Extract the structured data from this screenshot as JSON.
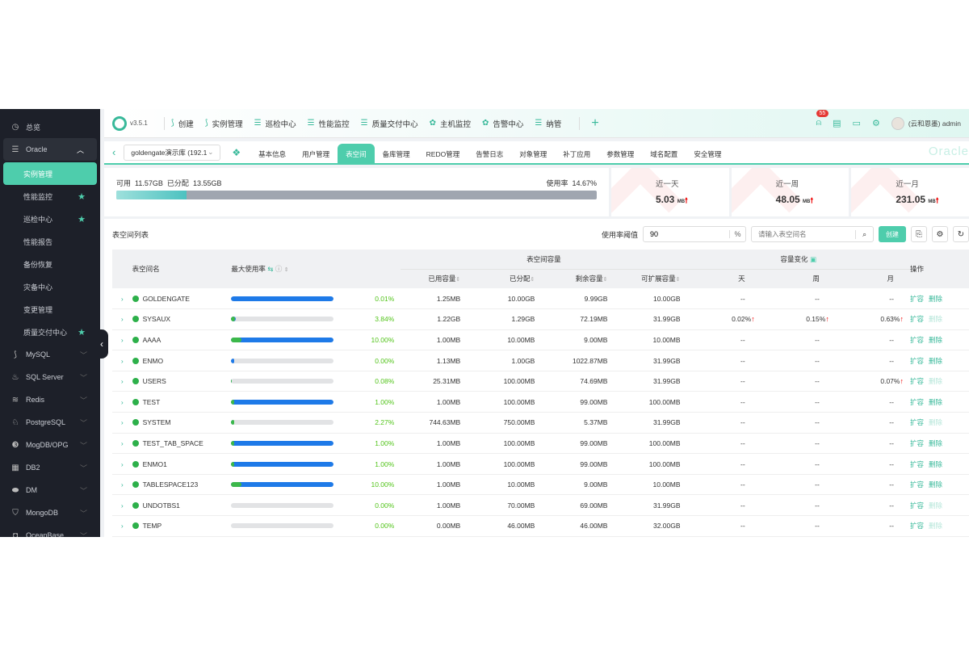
{
  "sidebar": {
    "overview": "总览",
    "oracle": "Oracle",
    "oracle_items": [
      {
        "label": "实例管理",
        "active": true,
        "star": false
      },
      {
        "label": "性能监控",
        "star": true
      },
      {
        "label": "巡检中心",
        "star": true
      },
      {
        "label": "性能报告",
        "star": false
      },
      {
        "label": "备份恢复",
        "star": false
      },
      {
        "label": "灾备中心",
        "star": false
      },
      {
        "label": "变更管理",
        "star": false
      },
      {
        "label": "质量交付中心",
        "star": true
      }
    ],
    "groups": [
      "MySQL",
      "SQL Server",
      "Redis",
      "PostgreSQL",
      "MogDB/OPG",
      "DB2",
      "DM",
      "MongoDB",
      "OceanBase"
    ]
  },
  "topbar": {
    "version": "v3.5.1",
    "nav": [
      "创建",
      "实例管理",
      "巡检中心",
      "性能监控",
      "质量交付中心",
      "主机监控",
      "告警中心",
      "纳管"
    ],
    "alert_count": "55",
    "user": "(云和恩墨) admin"
  },
  "subbar": {
    "instance": "goldengate演示库 (192.1",
    "tabs": [
      "基本信息",
      "用户管理",
      "表空间",
      "备库管理",
      "REDO管理",
      "告警日志",
      "对象管理",
      "补丁应用",
      "参数管理",
      "域名配置",
      "安全管理"
    ],
    "active_tab": "表空间",
    "brand": "Oracle"
  },
  "usage": {
    "available_label": "可用",
    "available": "11.57GB",
    "allocated_label": "已分配",
    "allocated": "13.55GB",
    "rate_label": "使用率",
    "rate": "14.67%",
    "rate_value": 14.67
  },
  "growth": [
    {
      "label": "近一天",
      "value": "5.03",
      "unit": "MB"
    },
    {
      "label": "近一周",
      "value": "48.05",
      "unit": "MB"
    },
    {
      "label": "近一月",
      "value": "231.05",
      "unit": "MB"
    }
  ],
  "list": {
    "title": "表空间列表",
    "threshold_label": "使用率阈值",
    "threshold": "90",
    "threshold_unit": "%",
    "search_placeholder": "请输入表空间名",
    "create": "创建",
    "headers": {
      "name": "表空间名",
      "max_usage": "最大使用率",
      "capacity": "表空间容量",
      "used": "已用容量",
      "allocated": "已分配",
      "remaining": "剩余容量",
      "extendable": "可扩展容量",
      "change": "容量变化",
      "day": "天",
      "week": "周",
      "month": "月",
      "ops": "操作"
    },
    "op_expand": "扩容",
    "op_delete": "删除",
    "rows": [
      {
        "name": "GOLDENGATE",
        "pct": "0.01%",
        "used_fill": 0.01,
        "alloc_fill": 100,
        "used": "1.25MB",
        "allocated": "10.00GB",
        "remaining": "9.99GB",
        "extendable": "10.00GB",
        "day": "--",
        "week": "--",
        "month": "--",
        "delete_enabled": true
      },
      {
        "name": "SYSAUX",
        "pct": "3.84%",
        "used_fill": 3.84,
        "alloc_fill": 4,
        "used": "1.22GB",
        "allocated": "1.29GB",
        "remaining": "72.19MB",
        "extendable": "31.99GB",
        "day": "0.02%",
        "week": "0.15%",
        "month": "0.63%",
        "delete_enabled": false
      },
      {
        "name": "AAAA",
        "pct": "10.00%",
        "used_fill": 10,
        "alloc_fill": 100,
        "used": "1.00MB",
        "allocated": "10.00MB",
        "remaining": "9.00MB",
        "extendable": "10.00MB",
        "day": "--",
        "week": "--",
        "month": "--",
        "delete_enabled": true
      },
      {
        "name": "ENMO",
        "pct": "0.00%",
        "used_fill": 0,
        "alloc_fill": 3,
        "used": "1.13MB",
        "allocated": "1.00GB",
        "remaining": "1022.87MB",
        "extendable": "31.99GB",
        "day": "--",
        "week": "--",
        "month": "--",
        "delete_enabled": true
      },
      {
        "name": "USERS",
        "pct": "0.08%",
        "used_fill": 0.08,
        "alloc_fill": 0.3,
        "used": "25.31MB",
        "allocated": "100.00MB",
        "remaining": "74.69MB",
        "extendable": "31.99GB",
        "day": "--",
        "week": "--",
        "month": "0.07%",
        "delete_enabled": false
      },
      {
        "name": "TEST",
        "pct": "1.00%",
        "used_fill": 1,
        "alloc_fill": 100,
        "used": "1.00MB",
        "allocated": "100.00MB",
        "remaining": "99.00MB",
        "extendable": "100.00MB",
        "day": "--",
        "week": "--",
        "month": "--",
        "delete_enabled": true
      },
      {
        "name": "SYSTEM",
        "pct": "2.27%",
        "used_fill": 2.27,
        "alloc_fill": 2.3,
        "used": "744.63MB",
        "allocated": "750.00MB",
        "remaining": "5.37MB",
        "extendable": "31.99GB",
        "day": "--",
        "week": "--",
        "month": "--",
        "delete_enabled": false
      },
      {
        "name": "TEST_TAB_SPACE",
        "pct": "1.00%",
        "used_fill": 1,
        "alloc_fill": 100,
        "used": "1.00MB",
        "allocated": "100.00MB",
        "remaining": "99.00MB",
        "extendable": "100.00MB",
        "day": "--",
        "week": "--",
        "month": "--",
        "delete_enabled": true
      },
      {
        "name": "ENMO1",
        "pct": "1.00%",
        "used_fill": 1,
        "alloc_fill": 100,
        "used": "1.00MB",
        "allocated": "100.00MB",
        "remaining": "99.00MB",
        "extendable": "100.00MB",
        "day": "--",
        "week": "--",
        "month": "--",
        "delete_enabled": true
      },
      {
        "name": "TABLESPACE123",
        "pct": "10.00%",
        "used_fill": 10,
        "alloc_fill": 100,
        "used": "1.00MB",
        "allocated": "10.00MB",
        "remaining": "9.00MB",
        "extendable": "10.00MB",
        "day": "--",
        "week": "--",
        "month": "--",
        "delete_enabled": true
      },
      {
        "name": "UNDOTBS1",
        "pct": "0.00%",
        "used_fill": 0,
        "alloc_fill": 0,
        "used": "1.00MB",
        "allocated": "70.00MB",
        "remaining": "69.00MB",
        "extendable": "31.99GB",
        "day": "--",
        "week": "--",
        "month": "--",
        "delete_enabled": false
      },
      {
        "name": "TEMP",
        "pct": "0.00%",
        "used_fill": 0,
        "alloc_fill": 0,
        "used": "0.00MB",
        "allocated": "46.00MB",
        "remaining": "46.00MB",
        "extendable": "32.00GB",
        "day": "--",
        "week": "--",
        "month": "--",
        "delete_enabled": false
      }
    ]
  },
  "colors": {
    "accent": "#4ecdac",
    "sidebar": "#1d2029",
    "bar_blue": "#1e7ae8",
    "bar_green": "#3cb84a",
    "up_arrow": "#e00000"
  }
}
